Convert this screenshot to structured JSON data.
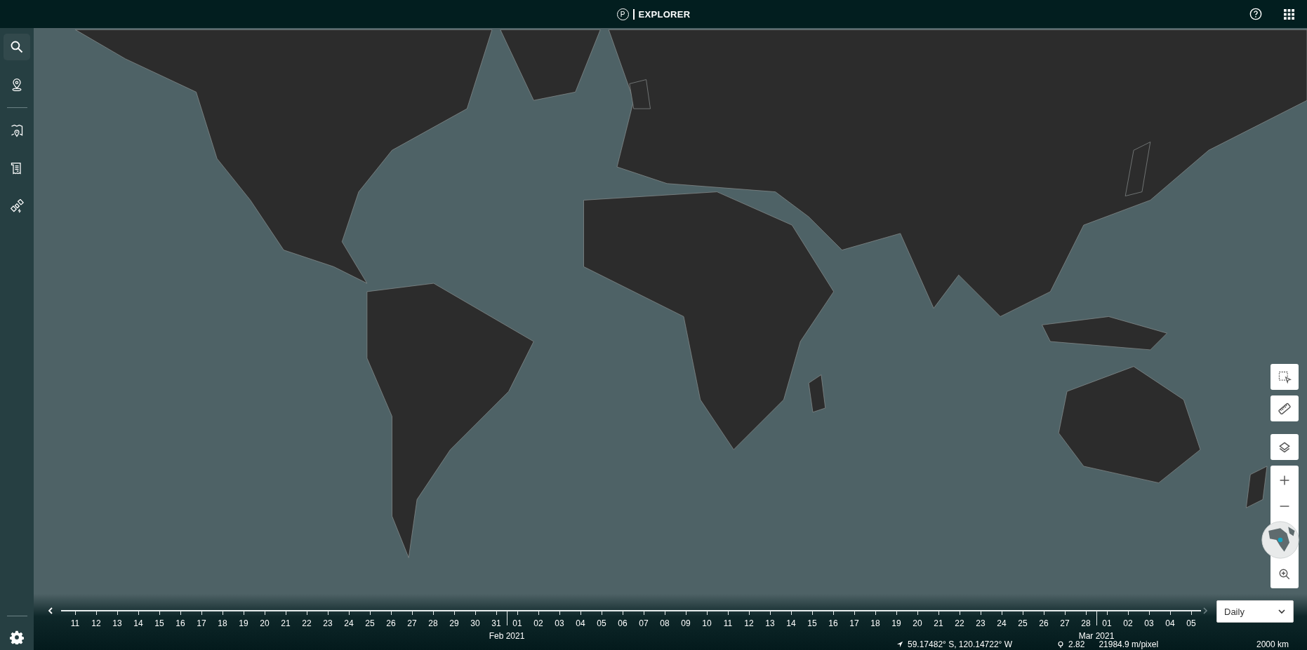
{
  "header": {
    "logo_letter": "P",
    "title": "EXPLORER"
  },
  "sidebar": {
    "sections": [
      {
        "items": [
          {
            "kind": "search",
            "selected": true
          },
          {
            "kind": "places",
            "selected": false
          }
        ]
      },
      {
        "items": [
          {
            "kind": "maps",
            "selected": false
          },
          {
            "kind": "reports",
            "selected": false
          },
          {
            "kind": "satellite",
            "selected": false
          }
        ]
      }
    ]
  },
  "timeline": {
    "days": [
      {
        "label": "11"
      },
      {
        "label": "12"
      },
      {
        "label": "13"
      },
      {
        "label": "14"
      },
      {
        "label": "15"
      },
      {
        "label": "16"
      },
      {
        "label": "17"
      },
      {
        "label": "18"
      },
      {
        "label": "19"
      },
      {
        "label": "20"
      },
      {
        "label": "21"
      },
      {
        "label": "22"
      },
      {
        "label": "23"
      },
      {
        "label": "24"
      },
      {
        "label": "25"
      },
      {
        "label": "26"
      },
      {
        "label": "27"
      },
      {
        "label": "28"
      },
      {
        "label": "29"
      },
      {
        "label": "30"
      },
      {
        "label": "31"
      },
      {
        "label": "01",
        "month": "Feb 2021"
      },
      {
        "label": "02"
      },
      {
        "label": "03"
      },
      {
        "label": "04"
      },
      {
        "label": "05"
      },
      {
        "label": "06"
      },
      {
        "label": "07"
      },
      {
        "label": "08"
      },
      {
        "label": "09"
      },
      {
        "label": "10"
      },
      {
        "label": "11"
      },
      {
        "label": "12"
      },
      {
        "label": "13"
      },
      {
        "label": "14"
      },
      {
        "label": "15"
      },
      {
        "label": "16"
      },
      {
        "label": "17"
      },
      {
        "label": "18"
      },
      {
        "label": "19"
      },
      {
        "label": "20"
      },
      {
        "label": "21"
      },
      {
        "label": "22"
      },
      {
        "label": "23"
      },
      {
        "label": "24"
      },
      {
        "label": "25"
      },
      {
        "label": "26"
      },
      {
        "label": "27"
      },
      {
        "label": "28"
      },
      {
        "label": "01",
        "month": "Mar 2021"
      },
      {
        "label": "02"
      },
      {
        "label": "03"
      },
      {
        "label": "04"
      },
      {
        "label": "05"
      }
    ],
    "interval": "Daily"
  },
  "status_bar": {
    "coordinates": "59.17482° S, 120.14722° W",
    "zoom": "2.82",
    "resolution": "21984.9 m/pixel",
    "scale": "2000 km"
  }
}
